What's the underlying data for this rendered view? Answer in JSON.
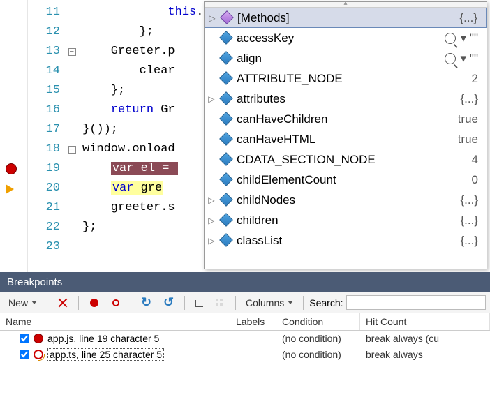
{
  "editor": {
    "lines": [
      {
        "num": 11,
        "html": "            <span class='kw'>this</span>."
      },
      {
        "num": 12,
        "html": "        };"
      },
      {
        "num": 13,
        "html": "    Greeter.p",
        "fold": "−"
      },
      {
        "num": 14,
        "html": "        clear"
      },
      {
        "num": 15,
        "html": "    };"
      },
      {
        "num": 16,
        "html": "    <span class='kw'>return</span> Gr"
      },
      {
        "num": 17,
        "html": "}());"
      },
      {
        "num": 18,
        "html": "window.onload",
        "fold": "−"
      },
      {
        "num": 19,
        "html": "    <span class='hl-red'><span style='color:#fff'>var</span> el = </span>",
        "bp": true
      },
      {
        "num": 20,
        "html": "    <span class='hl-yel'><span class='kw'>var</span> gre</span>",
        "arrow": true
      },
      {
        "num": 21,
        "html": "    greeter.s"
      },
      {
        "num": 22,
        "html": "};"
      },
      {
        "num": 23,
        "html": ""
      }
    ]
  },
  "popup": {
    "items": [
      {
        "exp": "▷",
        "iconClass": "cube purple",
        "label": "[Methods]",
        "val": "{...}",
        "selected": true
      },
      {
        "exp": "",
        "iconClass": "cube",
        "label": "accessKey",
        "val": "\"\"",
        "mag": true
      },
      {
        "exp": "",
        "iconClass": "cube",
        "label": "align",
        "val": "\"\"",
        "mag": true
      },
      {
        "exp": "",
        "iconClass": "cube",
        "label": "ATTRIBUTE_NODE",
        "val": "2"
      },
      {
        "exp": "▷",
        "iconClass": "cube",
        "label": "attributes",
        "val": "{...}"
      },
      {
        "exp": "",
        "iconClass": "cube",
        "label": "canHaveChildren",
        "val": "true"
      },
      {
        "exp": "",
        "iconClass": "cube",
        "label": "canHaveHTML",
        "val": "true"
      },
      {
        "exp": "",
        "iconClass": "cube",
        "label": "CDATA_SECTION_NODE",
        "val": "4"
      },
      {
        "exp": "",
        "iconClass": "cube",
        "label": "childElementCount",
        "val": "0"
      },
      {
        "exp": "▷",
        "iconClass": "cube",
        "label": "childNodes",
        "val": "{...}"
      },
      {
        "exp": "▷",
        "iconClass": "cube",
        "label": "children",
        "val": "{...}"
      },
      {
        "exp": "▷",
        "iconClass": "cube",
        "label": "classList",
        "val": "{...}"
      }
    ],
    "scroll_up": "▴",
    "scroll_expand": "◂"
  },
  "panel": {
    "title": "Breakpoints",
    "toolbar": {
      "new_label": "New",
      "columns_label": "Columns",
      "search_label": "Search:",
      "search_value": ""
    },
    "columns": {
      "name": "Name",
      "labels": "Labels",
      "condition": "Condition",
      "hitcount": "Hit Count"
    },
    "rows": [
      {
        "checked": true,
        "iconClass": "",
        "text": "app.js, line 19 character 5",
        "labels": "",
        "condition": "(no condition)",
        "hit": "break always (cu"
      },
      {
        "checked": true,
        "iconClass": "map",
        "text": "app.ts, line 25 character 5",
        "labels": "",
        "condition": "(no condition)",
        "hit": "break always",
        "selected": true
      }
    ]
  }
}
